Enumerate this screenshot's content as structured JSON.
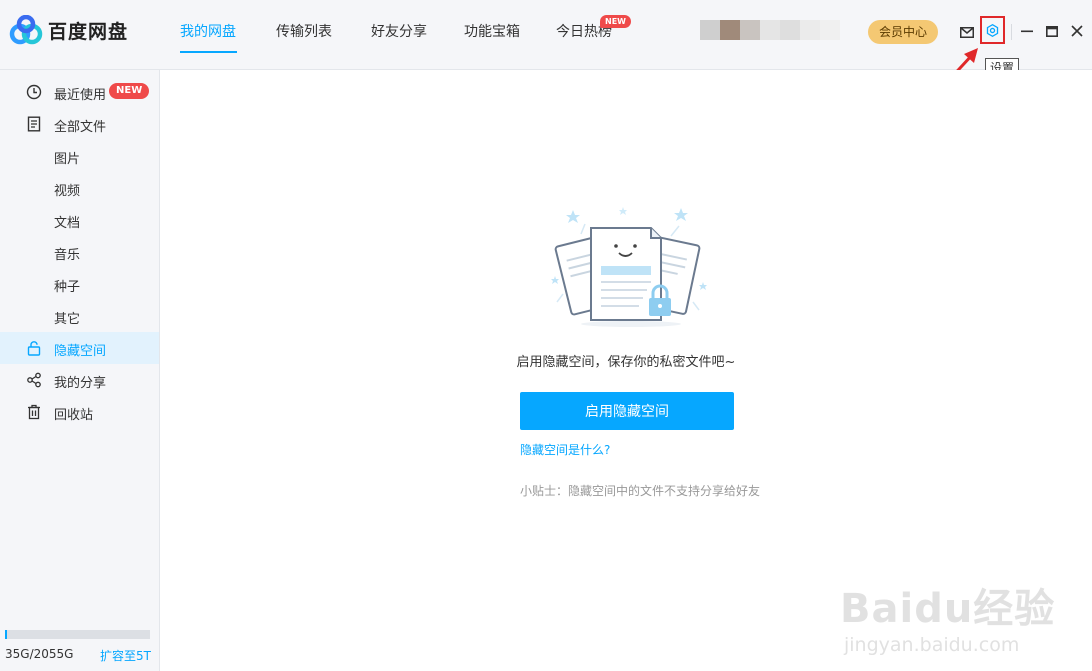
{
  "app": {
    "name": "百度网盘"
  },
  "nav": {
    "items": [
      {
        "label": "我的网盘",
        "active": true
      },
      {
        "label": "传输列表"
      },
      {
        "label": "好友分享"
      },
      {
        "label": "功能宝箱"
      },
      {
        "label": "今日热榜",
        "badge": "NEW"
      }
    ]
  },
  "header": {
    "vip_label": "会员中心",
    "settings_tooltip": "设置"
  },
  "sidebar": {
    "items": [
      {
        "label": "最近使用",
        "icon": "clock-icon",
        "badge": "NEW"
      },
      {
        "label": "全部文件",
        "icon": "document-icon"
      },
      {
        "label": "图片"
      },
      {
        "label": "视频"
      },
      {
        "label": "文档"
      },
      {
        "label": "音乐"
      },
      {
        "label": "种子"
      },
      {
        "label": "其它"
      },
      {
        "label": "隐藏空间",
        "icon": "lock-icon",
        "active": true
      },
      {
        "label": "我的分享",
        "icon": "share-icon"
      },
      {
        "label": "回收站",
        "icon": "trash-icon"
      }
    ],
    "storage_text": "35G/2055G",
    "storage_fraction": 0.017,
    "expand_label": "扩容至5T"
  },
  "main": {
    "message": "启用隐藏空间，保存你的私密文件吧~",
    "enable_button": "启用隐藏空间",
    "what_link": "隐藏空间是什么?",
    "tip": "小贴士：隐藏空间中的文件不支持分享给好友"
  },
  "watermark": {
    "brand": "Baidu经验",
    "url": "jingyan.baidu.com"
  },
  "colors": {
    "accent": "#06a7ff",
    "badge": "#ef4a4a",
    "vip": "#f4c873",
    "highlight": "#e0282a"
  }
}
